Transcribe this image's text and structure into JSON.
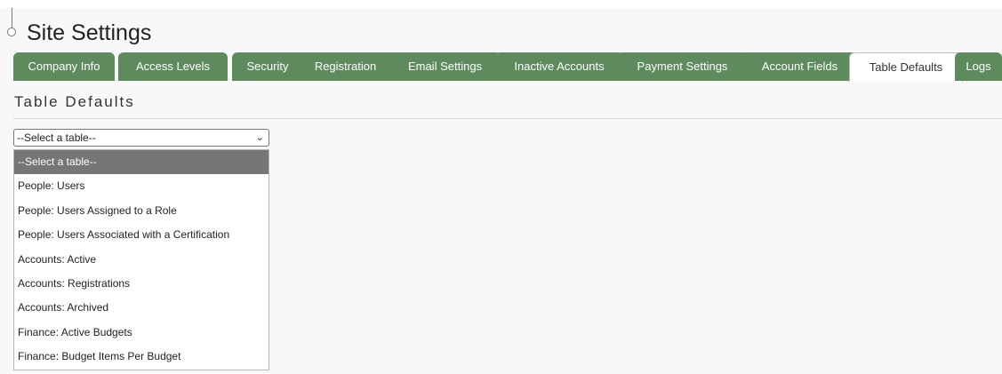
{
  "page": {
    "title": "Site Settings",
    "section_title": "Table Defaults"
  },
  "tabs": [
    {
      "label": "Company Info",
      "active": false
    },
    {
      "label": "Access Levels",
      "active": false
    },
    {
      "label": "Security",
      "active": false
    },
    {
      "label": "Registration",
      "active": false
    },
    {
      "label": "Email Settings",
      "active": false
    },
    {
      "label": "Inactive Accounts",
      "active": false
    },
    {
      "label": "Payment Settings",
      "active": false
    },
    {
      "label": "Account Fields",
      "active": false
    },
    {
      "label": "Table Defaults",
      "active": true
    },
    {
      "label": "Logs",
      "active": false
    }
  ],
  "table_select": {
    "value": "--Select a table--",
    "options": [
      "--Select a table--",
      "People: Users",
      "People: Users Assigned to a Role",
      "People: Users Associated with a Certification",
      "Accounts: Active",
      "Accounts: Registrations",
      "Accounts: Archived",
      "Finance: Active Budgets",
      "Finance: Budget Items Per Budget"
    ],
    "highlighted_index": 0
  },
  "colors": {
    "tab_bg": "#5e8b5e",
    "tab_text": "#ffffff",
    "option_highlight": "#767676"
  },
  "icons": {
    "select_chevron": "chevron-down-icon"
  }
}
